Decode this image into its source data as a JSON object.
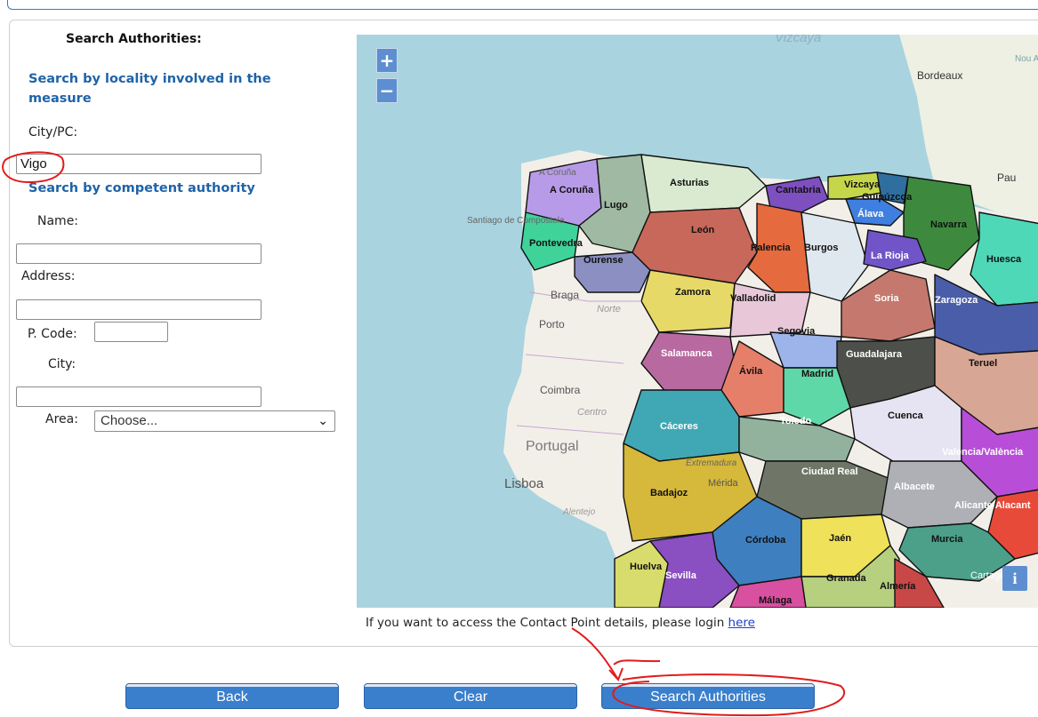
{
  "form": {
    "heading": "Search Authorities:",
    "locality_section_title": "Search by locality involved in the measure",
    "city_pc_label": "City/PC:",
    "city_pc_value": "Vigo",
    "authority_section_title": "Search by competent authority",
    "name_label": "Name:",
    "name_value": "",
    "address_label": "Address:",
    "address_value": "",
    "pcode_label": "P. Code:",
    "pcode_value": "",
    "city_label": "City:",
    "city_value": "",
    "area_label": "Area:",
    "area_selected": "Choose..."
  },
  "map": {
    "zoom_in": "+",
    "zoom_out": "−",
    "info": "i",
    "labels": {
      "vizcaya_sea": "Vizcaya",
      "bordeaux": "Bordeaux",
      "nou_aqu": "Nou Aqu",
      "pau": "Pau",
      "a_coruna_city": "A Coruña",
      "santiago": "Santiago de Compostela",
      "braga": "Braga",
      "norte": "Norte",
      "porto": "Porto",
      "coimbra": "Coimbra",
      "centro": "Centro",
      "portugal": "Portugal",
      "lisboa": "Lisboa",
      "alentejo": "Alentejo",
      "merida": "Mérida",
      "extremadura": "Extremadura",
      "cartagena": "Cartagena"
    },
    "provinces": [
      "A Coruña",
      "Lugo",
      "Asturias",
      "Cantabria",
      "Vizcaya",
      "Guipúzcoa",
      "Álava",
      "Navarra",
      "Pontevedra",
      "Ourense",
      "León",
      "Palencia",
      "Burgos",
      "La Rioja",
      "Huesca",
      "Zamora",
      "Valladolid",
      "Soria",
      "Zaragoza",
      "Segovia",
      "Salamanca",
      "Ávila",
      "Madrid",
      "Guadalajara",
      "Teruel",
      "Cáceres",
      "Toledo",
      "Cuenca",
      "Valencia/València",
      "Badajoz",
      "Ciudad Real",
      "Albacete",
      "Alicante/Alacant",
      "Córdoba",
      "Jaén",
      "Murcia",
      "Huelva",
      "Sevilla",
      "Granada",
      "Almería",
      "Málaga"
    ],
    "colors": {
      "sea": "#a9d3df",
      "land": "#f2efe9",
      "border": "#111111"
    }
  },
  "footer": {
    "login_text": "If you want to access the Contact Point details, please login",
    "login_link": "here"
  },
  "buttons": {
    "back": "Back",
    "clear": "Clear",
    "search": "Search Authorities"
  }
}
